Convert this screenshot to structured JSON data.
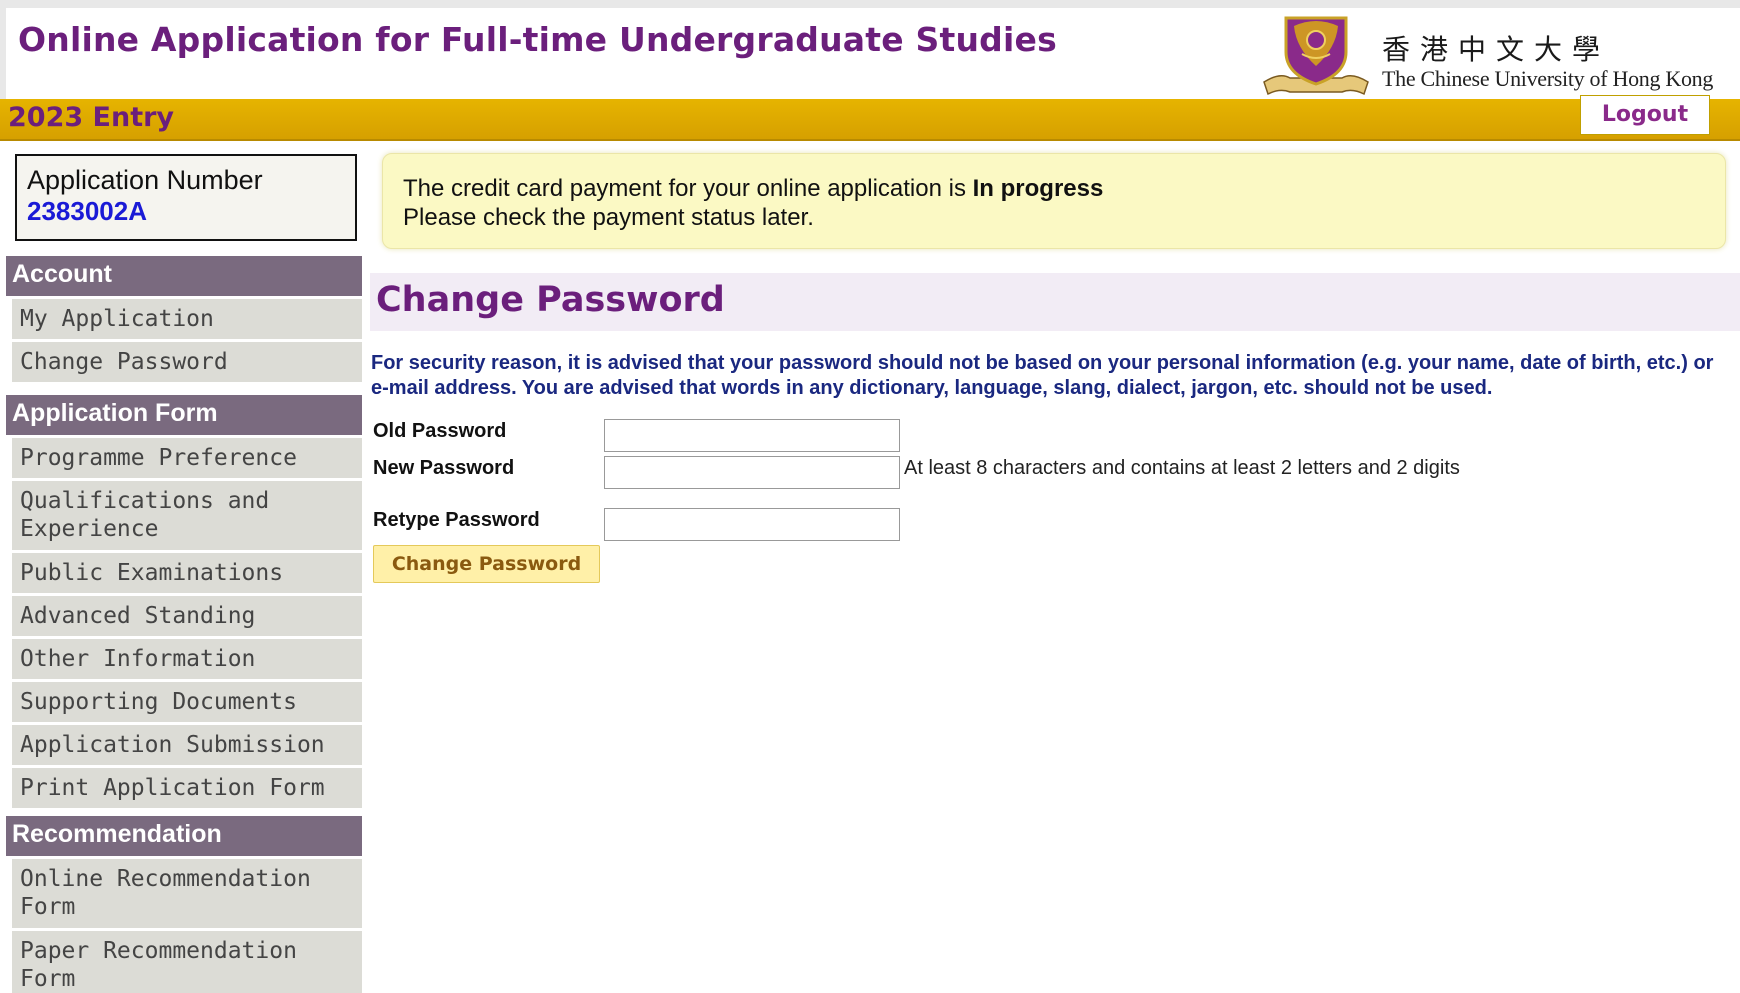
{
  "header": {
    "title": "Online Application for Full-time Undergraduate Studies",
    "university_name_chinese": "香港中文大學",
    "university_name_english": "The Chinese University of Hong Kong",
    "entry_label": "2023 Entry",
    "logout_label": "Logout"
  },
  "sidebar": {
    "application_number_label": "Application Number",
    "application_number": "2383002A",
    "sections": [
      {
        "title": "Account",
        "items": [
          {
            "label": "My Application"
          },
          {
            "label": "Change Password"
          }
        ]
      },
      {
        "title": "Application Form",
        "items": [
          {
            "label": "Programme Preference"
          },
          {
            "label": "Qualifications and Experience"
          },
          {
            "label": "Public Examinations"
          },
          {
            "label": "Advanced Standing"
          },
          {
            "label": "Other Information"
          },
          {
            "label": "Supporting Documents"
          },
          {
            "label": "Application Submission"
          },
          {
            "label": "Print Application Form"
          }
        ]
      },
      {
        "title": "Recommendation",
        "items": [
          {
            "label": "Online Recommendation Form"
          },
          {
            "label": "Paper Recommendation Form"
          }
        ]
      }
    ]
  },
  "notice": {
    "line1_prefix": "The credit card payment for your online application is ",
    "line1_status": "In progress",
    "line2": "Please check the payment status later."
  },
  "main": {
    "page_title": "Change Password",
    "security_note": "For security reason, it is advised that your password should not be based on your personal information (e.g. your name, date of birth, etc.) or e-mail address. You are advised that words in any dictionary, language, slang, dialect, jargon, etc. should not be used.",
    "form": {
      "old_password_label": "Old Password",
      "old_password_value": "",
      "new_password_label": "New Password",
      "new_password_value": "",
      "new_password_hint": "At least 8 characters and contains at least 2 letters and 2 digits",
      "retype_password_label": "Retype Password",
      "retype_password_value": "",
      "submit_label": "Change Password"
    }
  },
  "colors": {
    "brand_purple": "#6b1f7c",
    "header_gold": "#e6b400",
    "sidebar_header": "#7a6a7f",
    "sidebar_item": "#dcdcd6",
    "notice_bg": "#fbf9c4",
    "note_text": "#1a2880",
    "app_number": "#1a1ad6"
  }
}
